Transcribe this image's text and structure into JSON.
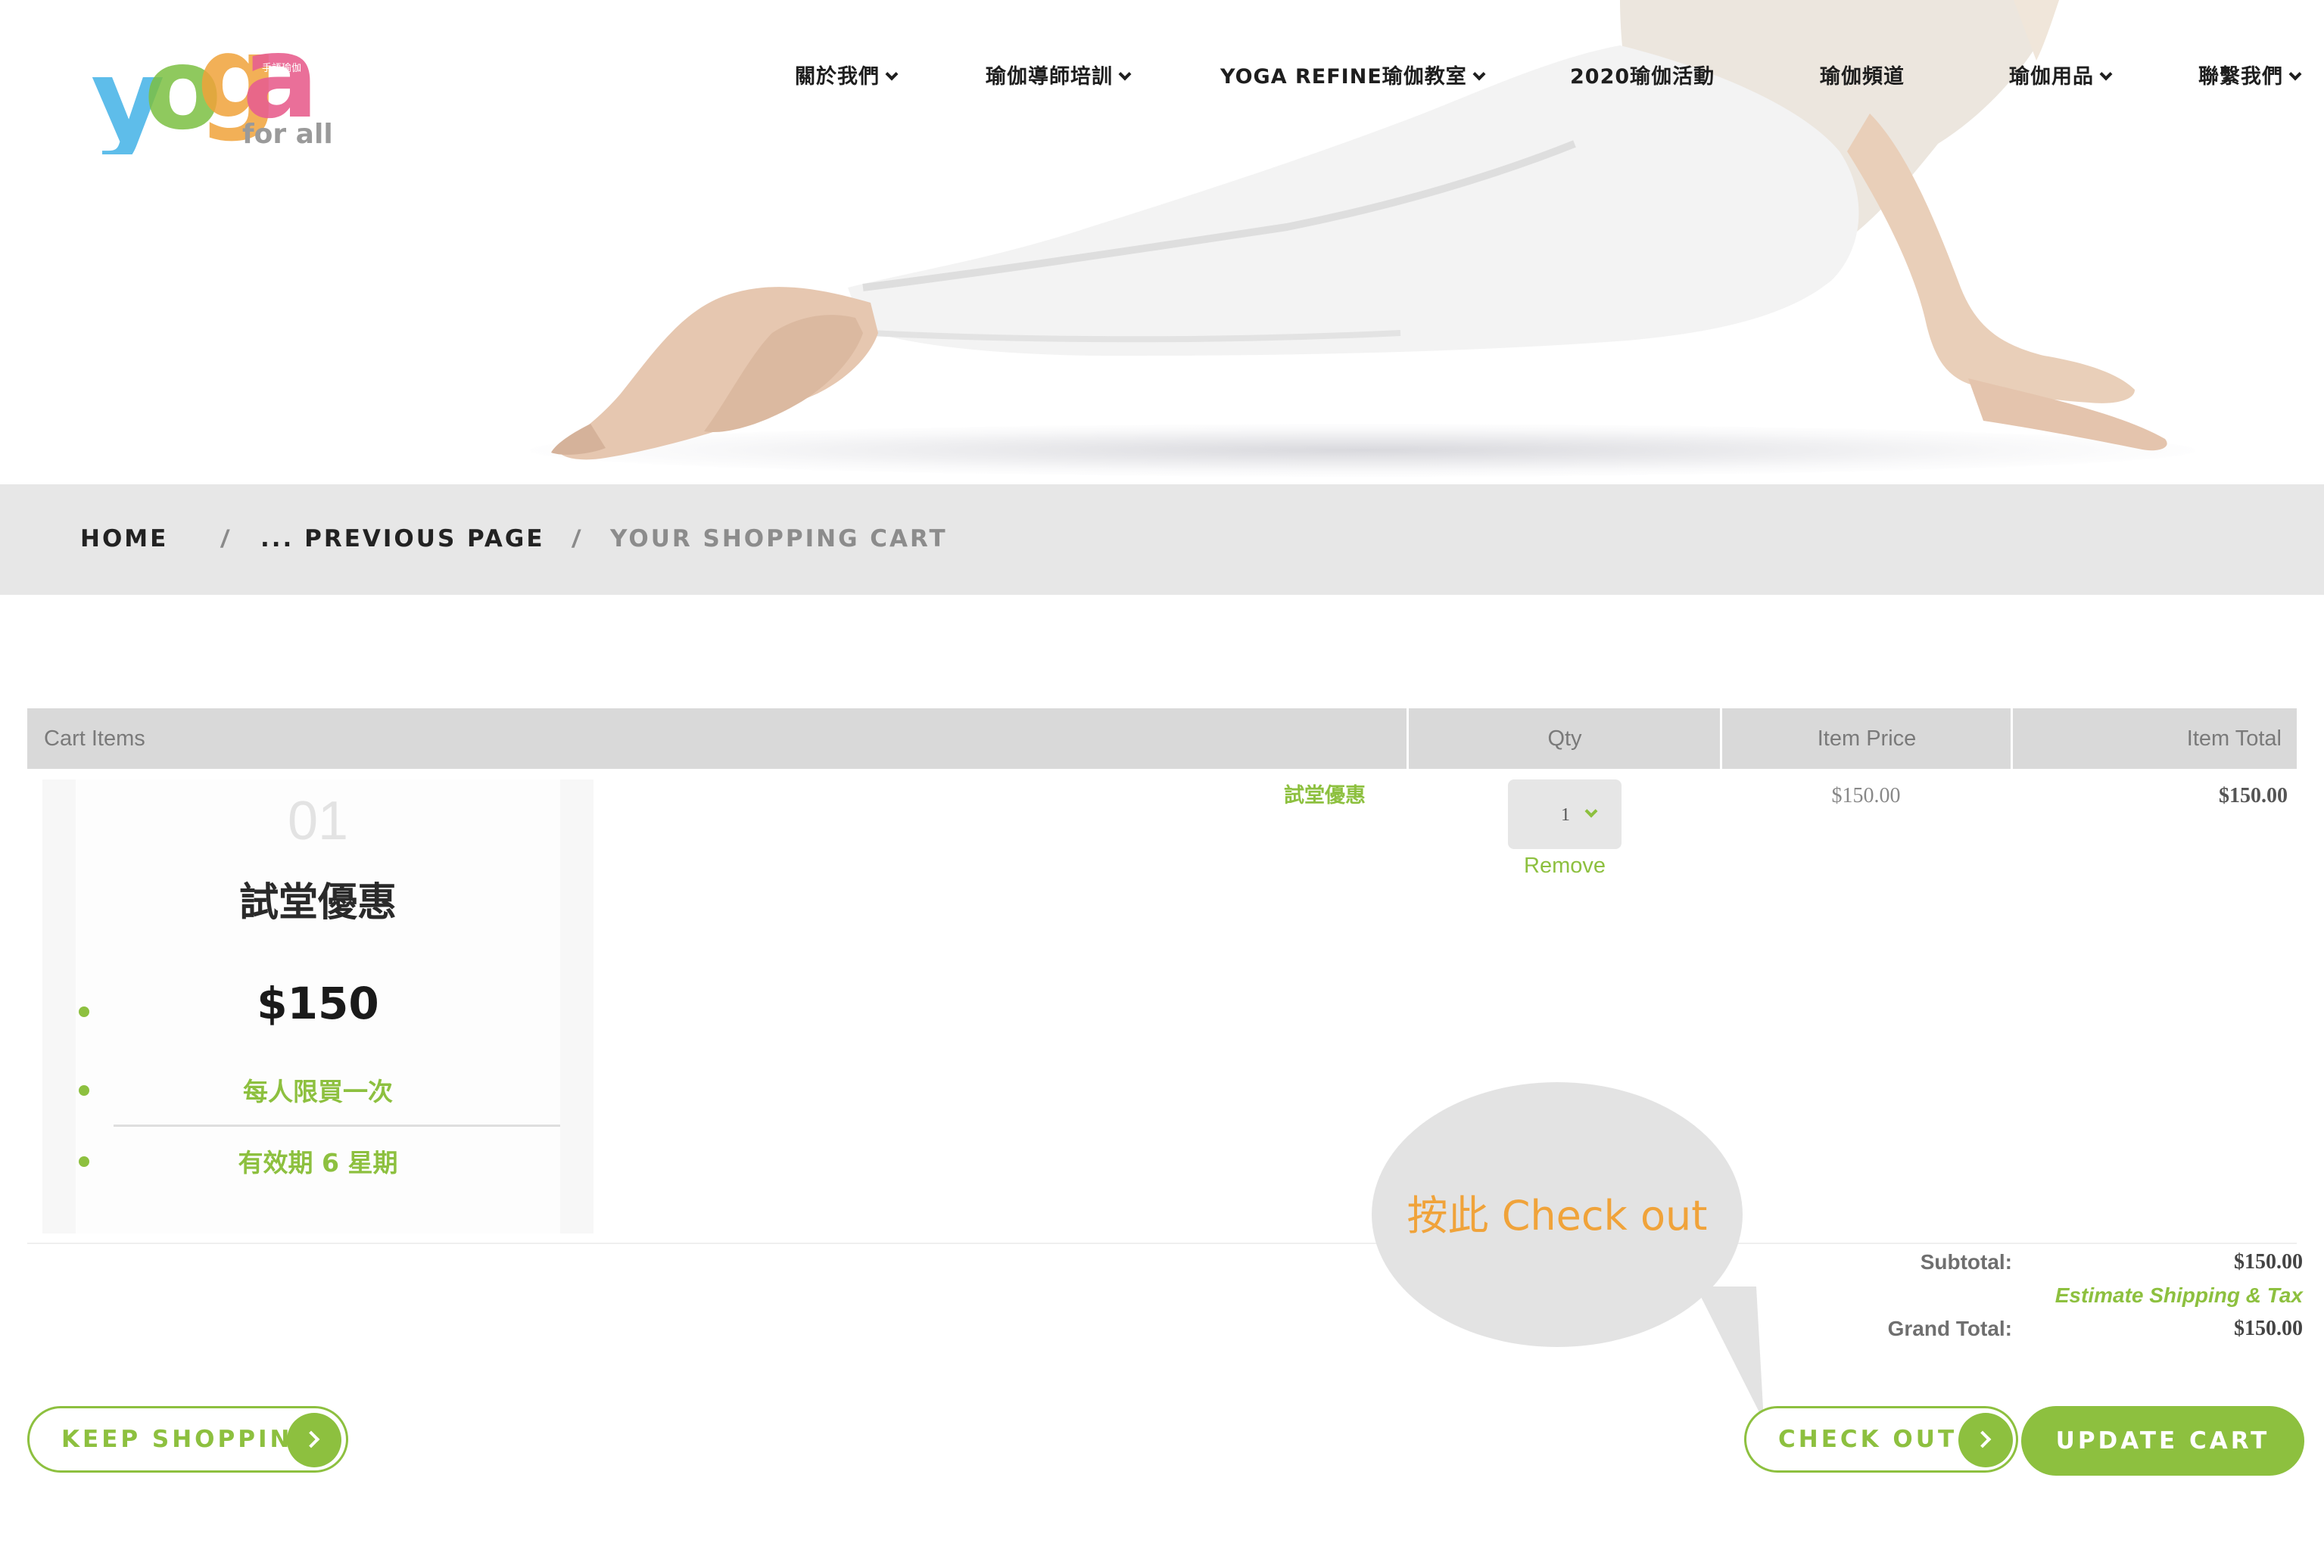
{
  "brand": {
    "logo_text": "yoga",
    "logo_sub": "for all",
    "logo_small": "手語瑜伽"
  },
  "nav": {
    "items": [
      {
        "label": "關於我們",
        "dropdown": true
      },
      {
        "label": "瑜伽導師培訓",
        "dropdown": true
      },
      {
        "label": "YOGA REFINE瑜伽教室",
        "dropdown": true
      },
      {
        "label": "2020瑜伽活動",
        "dropdown": false
      },
      {
        "label": "瑜伽頻道",
        "dropdown": false
      },
      {
        "label": "瑜伽用品",
        "dropdown": true
      },
      {
        "label": "聯繫我們",
        "dropdown": true
      }
    ]
  },
  "breadcrumb": {
    "home": "HOME",
    "previous": "... PREVIOUS PAGE",
    "current": "YOUR SHOPPING CART",
    "separator": "/"
  },
  "cart": {
    "columns": {
      "items": "Cart Items",
      "qty": "Qty",
      "price": "Item Price",
      "total": "Item Total"
    },
    "items": [
      {
        "name": "試堂優惠",
        "qty": "1",
        "remove_label": "Remove",
        "price": "$150.00",
        "total": "$150.00",
        "image": {
          "number": "01",
          "title": "試堂優惠",
          "price": "$150",
          "line1": "每人限買一次",
          "line2": "有效期 6 星期"
        }
      }
    ],
    "summary": {
      "subtotal_label": "Subtotal:",
      "subtotal_value": "$150.00",
      "estimate_link": "Estimate Shipping & Tax",
      "grand_total_label": "Grand Total:",
      "grand_total_value": "$150.00"
    }
  },
  "actions": {
    "keep_shopping": "KEEP SHOPPING",
    "check_out": "CHECK OUT",
    "update_cart": "UPDATE CART"
  },
  "annotation": {
    "text": "按此 Check out"
  },
  "colors": {
    "accent": "#8dc03f",
    "breadcrumb_bg": "#e7e7e7",
    "table_header_bg": "#d9d9d9",
    "annotation_text": "#f0a33a",
    "annotation_bubble": "#e3e3e3"
  }
}
